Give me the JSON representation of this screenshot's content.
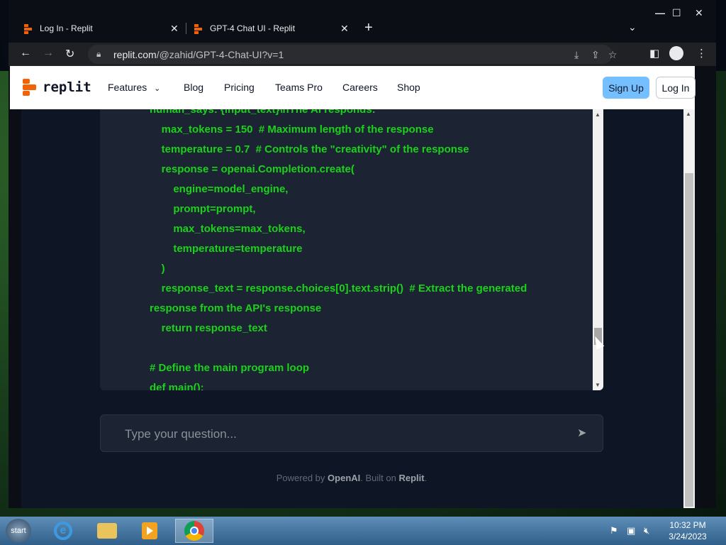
{
  "browser": {
    "tabs": [
      {
        "title": "Log In - Replit",
        "close": "✕"
      },
      {
        "title": "GPT-4 Chat UI - Replit",
        "close": "✕"
      }
    ],
    "new_tab": "+",
    "url_host": "replit.com",
    "url_path": "/@zahid/GPT-4-Chat-UI?v=1"
  },
  "site": {
    "logo_text": "replit",
    "nav": [
      {
        "label": "Features"
      },
      {
        "label": "Blog"
      },
      {
        "label": "Pricing"
      },
      {
        "label": "Teams Pro"
      },
      {
        "label": "Careers"
      },
      {
        "label": "Shop"
      }
    ],
    "signup": "Sign Up",
    "login": "Log In"
  },
  "code": {
    "lines": [
      "human_says: {input_text}\\nThe AI responds:",
      "    max_tokens = 150  # Maximum length of the response",
      "    temperature = 0.7  # Controls the \"creativity\" of the response",
      "    response = openai.Completion.create(",
      "        engine=model_engine,",
      "        prompt=prompt,",
      "        max_tokens=max_tokens,",
      "        temperature=temperature",
      "    )",
      "    response_text = response.choices[0].text.strip()  # Extract the generated",
      "response from the API's response",
      "    return response_text",
      "",
      "# Define the main program loop",
      "def main():"
    ]
  },
  "ask": {
    "placeholder": "Type your question..."
  },
  "footer": {
    "prefix": "Powered by ",
    "openai": "OpenAI",
    "middle": ". Built on ",
    "replit": "Replit",
    "suffix": "."
  },
  "taskbar": {
    "start": "start",
    "time": "10:32 PM",
    "date": "3/24/2023"
  }
}
